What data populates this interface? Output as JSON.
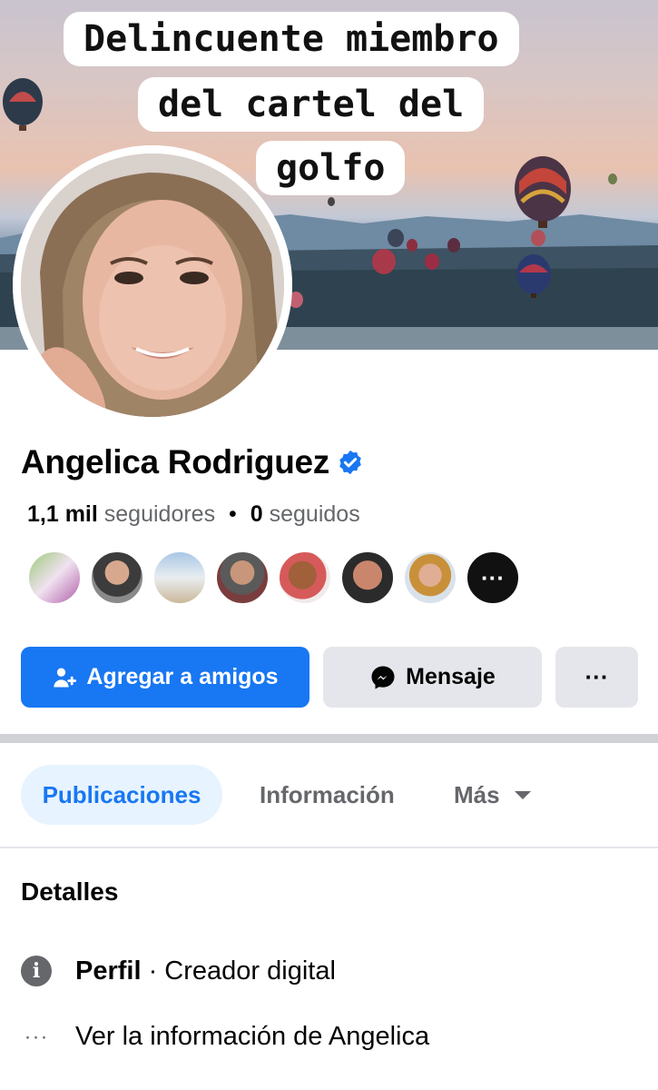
{
  "cover": {
    "caption_lines": [
      "Delincuente miembro",
      "del cartel del",
      "golfo"
    ]
  },
  "profile": {
    "name": "Angelica Rodriguez",
    "followers_count": "1,1 mil",
    "followers_label": "seguidores",
    "following_count": "0",
    "following_label": "seguidos",
    "dot": "•"
  },
  "friends_more": "···",
  "buttons": {
    "add_friend": "Agregar a amigos",
    "message": "Mensaje",
    "more": "···"
  },
  "tabs": {
    "posts": "Publicaciones",
    "info": "Información",
    "more": "Más"
  },
  "details": {
    "title": "Detalles",
    "profile_label": "Perfil",
    "profile_value": " · Creador digital",
    "see_info": "Ver la información de Angelica"
  },
  "colors": {
    "accent": "#1877f2",
    "accent_light": "#e7f3ff",
    "button_gray": "#e4e6eb",
    "secondary_text": "#65676b"
  }
}
